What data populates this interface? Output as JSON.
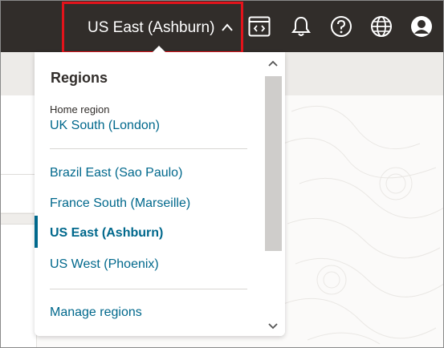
{
  "header": {
    "region_label": "US East (Ashburn)",
    "icons": [
      "code-console-icon",
      "bell-icon",
      "help-icon",
      "globe-icon",
      "user-avatar-icon"
    ]
  },
  "dropdown": {
    "title": "Regions",
    "home_label": "Home region",
    "home_region": "UK South (London)",
    "regions": [
      "Brazil East (Sao Paulo)",
      "France South (Marseille)",
      "US East (Ashburn)",
      "US West (Phoenix)"
    ],
    "active_region": "US East (Ashburn)",
    "manage_label": "Manage regions"
  },
  "colors": {
    "header_bg": "#312d2a",
    "link": "#00688c",
    "highlight_box": "#e3131b"
  }
}
